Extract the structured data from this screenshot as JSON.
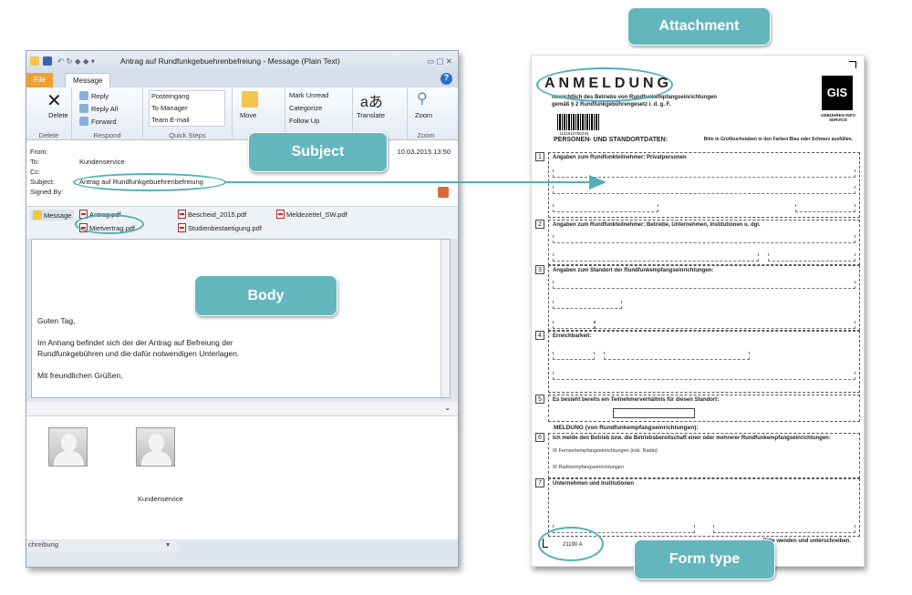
{
  "outlook": {
    "title": "Antrag auf Rundfunkgebuehrenbefreiung - Message (Plain Text)",
    "tabs": [
      "File",
      "Message"
    ],
    "ribbon": {
      "delete_group": {
        "label": "Delete",
        "delete": "Delete"
      },
      "respond_group": {
        "label": "Respond",
        "reply": "Reply",
        "reply_all": "Reply All",
        "forward": "Forward"
      },
      "quick_steps": {
        "label": "Quick Steps",
        "items": [
          "Posteingang",
          "To Manager",
          "Team E-mail"
        ]
      },
      "move_group": {
        "move": "Move"
      },
      "tags_group": {
        "mark_unread": "Mark Unread",
        "categorize": "Categorize",
        "follow_up": "Follow Up"
      },
      "translate": "Translate",
      "zoom_group": {
        "label": "Zoom",
        "zoom": "Zoom"
      }
    },
    "header": {
      "from_label": "From:",
      "to_label": "To:",
      "cc_label": "Cc:",
      "subject_label": "Subject:",
      "signed_label": "Signed By:",
      "to": "Kundenservice",
      "subject": "Antrag auf Rundfunkgebuehrenbefreiung",
      "sent": "10.03.2015 13:50"
    },
    "attachments": {
      "message": "Message",
      "files": [
        "Antrag.pdf",
        "Bescheid_2015.pdf",
        "Meldezettel_SW.pdf",
        "Mietvertrag.pdf",
        "Studienbestaetigung.pdf"
      ]
    },
    "body": {
      "greeting": "Guten Tag,",
      "line1": "Im Anhang befindet sich der der Antrag auf Befreiung der",
      "line2": "Rundfunkgebühren und die dafür notwendigen Unterlagen.",
      "closing": "Mit freundlichen Grüßen,"
    },
    "people": {
      "contact": "Kundenservice"
    },
    "bottom_field": "chreibung"
  },
  "form": {
    "title": "ANMELDUNG",
    "subtitle1": "hinsichtlich des Betriebs von Rundfunkempfangseinrichtungen",
    "subtitle2": "gemäß § 2 Rundfunkgebührengesetz i. d. g. F.",
    "logo": "GIS",
    "logo_sub": "GEBÜHREN INFO SERVICE",
    "barcode_number": "1122810756235",
    "personen": "PERSONEN- UND STANDORTDATEN:",
    "instructions": "Bitte in Großbuchstaben in den Farben Blau oder Schwarz ausfüllen.",
    "sections": [
      {
        "num": "1",
        "title": "Angaben zum Rundfunkteilnehmer: Privatpersonen"
      },
      {
        "num": "2",
        "title": "Angaben zum Rundfunkteilnehmer: Betriebe, Unternehmen, Institutionen u. dgl."
      },
      {
        "num": "3",
        "title": "Angaben zum Standort der Rundfunkempfangseinrichtungen:"
      },
      {
        "num": "4",
        "title": "Erreichbarkeit:"
      },
      {
        "num": "5",
        "title": "Es besteht bereits ein Teilnehmerverhältnis für diesen Standort:"
      },
      {
        "num": "6",
        "title": "Ich melde den Betrieb bzw. die Betriebsbereitschaft einer oder mehrerer Rundfunkempfangseinrichtungen:"
      },
      {
        "num": "7",
        "title": "Unternehmen und Institutionen"
      }
    ],
    "meldung": "MELDUNG (von Rundfunkempfangseinrichtungen):",
    "option_tv": "Fernsehempfangseinrichtungen (inkl. Radio)",
    "option_radio": "Radioempfangseinrichtungen",
    "form_number": "21190 A",
    "footer": "Bitte wenden und unterschreiben."
  },
  "callouts": {
    "attachment": "Attachment",
    "subject": "Subject",
    "body": "Body",
    "form_type": "Form type"
  },
  "colors": {
    "callout": "#63b6bc",
    "highlight": "#4fb0b7"
  }
}
